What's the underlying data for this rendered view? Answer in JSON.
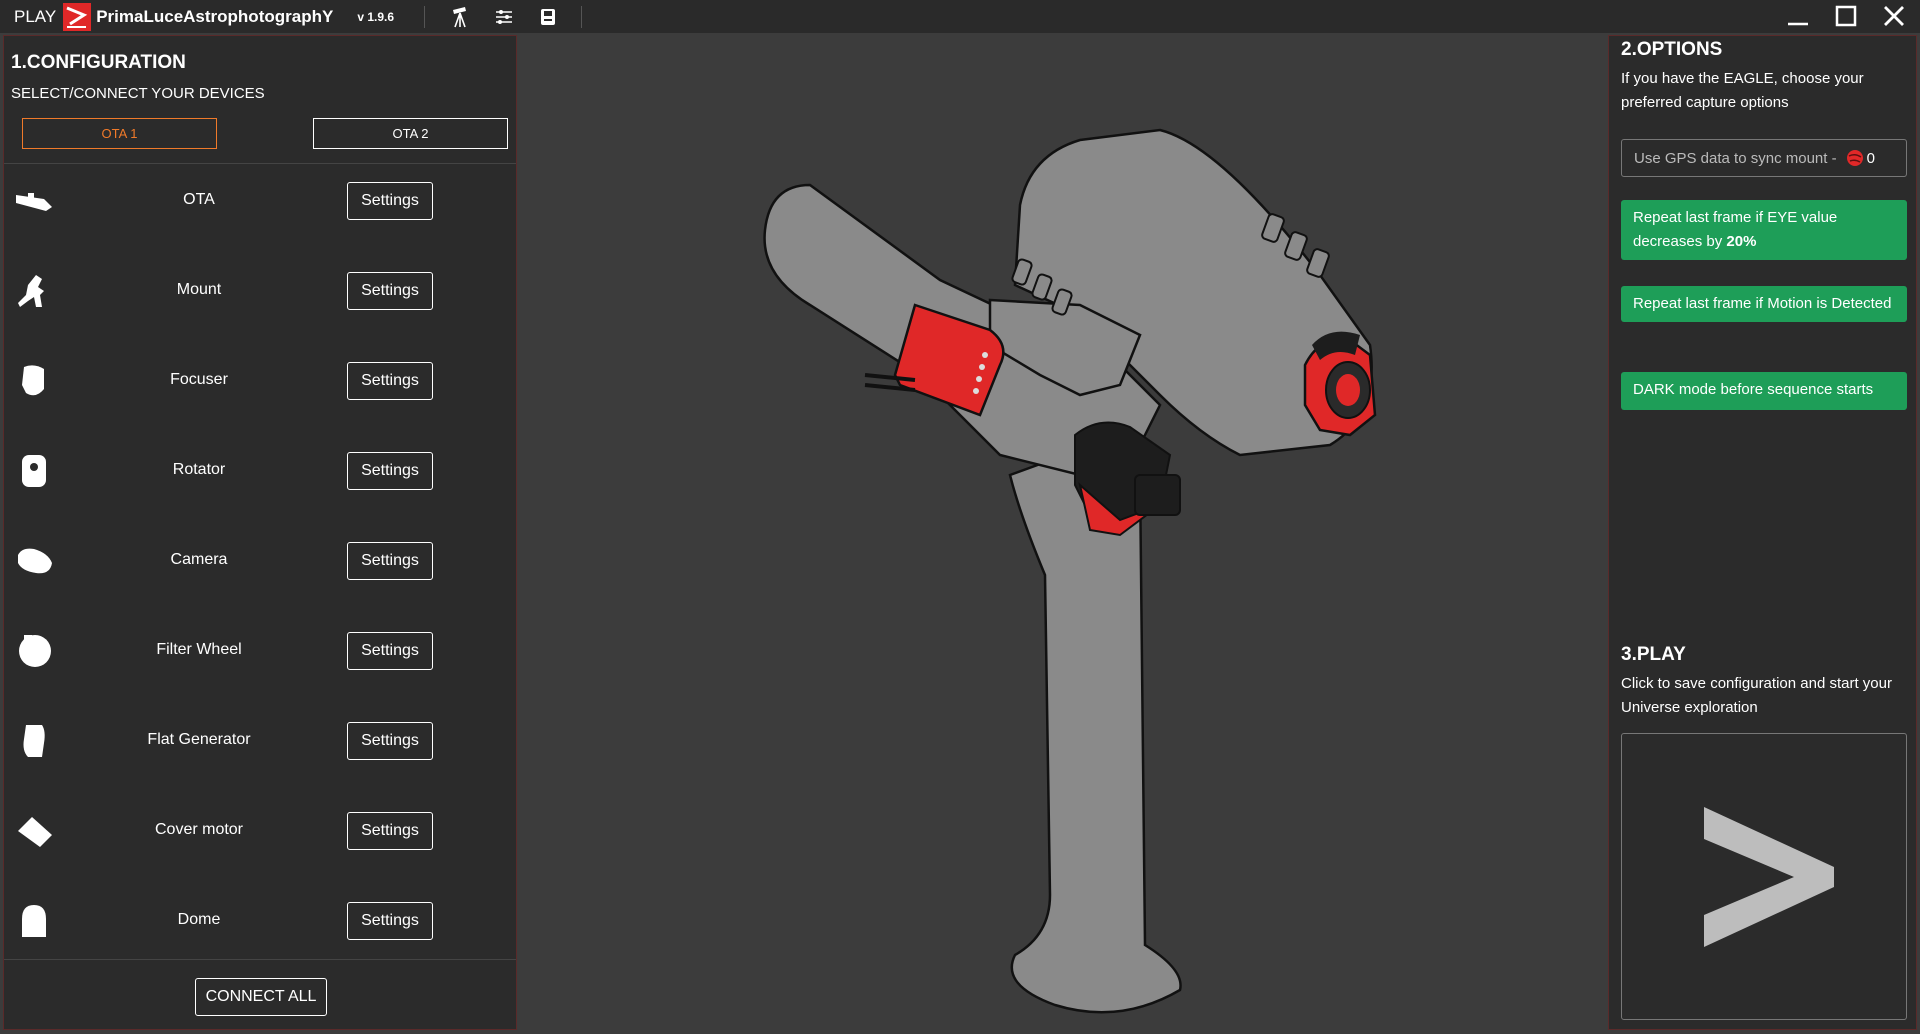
{
  "titlebar": {
    "play_label": "PLAY",
    "brand": "PrimaLuceAstrophotographY",
    "version": "v 1.9.6",
    "accent_color": "#e02828"
  },
  "config": {
    "title": "1.CONFIGURATION",
    "subtitle": "SELECT/CONNECT YOUR DEVICES",
    "ota_tabs": [
      "OTA 1",
      "OTA 2"
    ],
    "active_tab_color": "#f07a2a",
    "devices": [
      {
        "label": "OTA",
        "button": "Settings",
        "icon": "telescope-icon"
      },
      {
        "label": "Mount",
        "button": "Settings",
        "icon": "mount-icon"
      },
      {
        "label": "Focuser",
        "button": "Settings",
        "icon": "focuser-icon"
      },
      {
        "label": "Rotator",
        "button": "Settings",
        "icon": "rotator-icon"
      },
      {
        "label": "Camera",
        "button": "Settings",
        "icon": "camera-icon"
      },
      {
        "label": "Filter Wheel",
        "button": "Settings",
        "icon": "filter-wheel-icon"
      },
      {
        "label": "Flat Generator",
        "button": "Settings",
        "icon": "flat-generator-icon"
      },
      {
        "label": "Cover motor",
        "button": "Settings",
        "icon": "cover-motor-icon"
      },
      {
        "label": "Dome",
        "button": "Settings",
        "icon": "dome-icon"
      }
    ],
    "connect_all": "CONNECT ALL"
  },
  "options": {
    "title": "2.OPTIONS",
    "subtitle": "If you have the EAGLE, choose your preferred capture options",
    "gps_label": "Use GPS data to sync mount  -",
    "gps_count": "0",
    "repeat_eye_prefix": "Repeat last frame if EYE value decreases by ",
    "repeat_eye_value": "20%",
    "repeat_motion": "Repeat last frame if Motion is Detected",
    "dark_mode": "DARK mode before sequence starts",
    "button_color": "#1e9e58"
  },
  "play": {
    "title": "3.PLAY",
    "subtitle": "Click to save configuration and start your Universe exploration"
  }
}
